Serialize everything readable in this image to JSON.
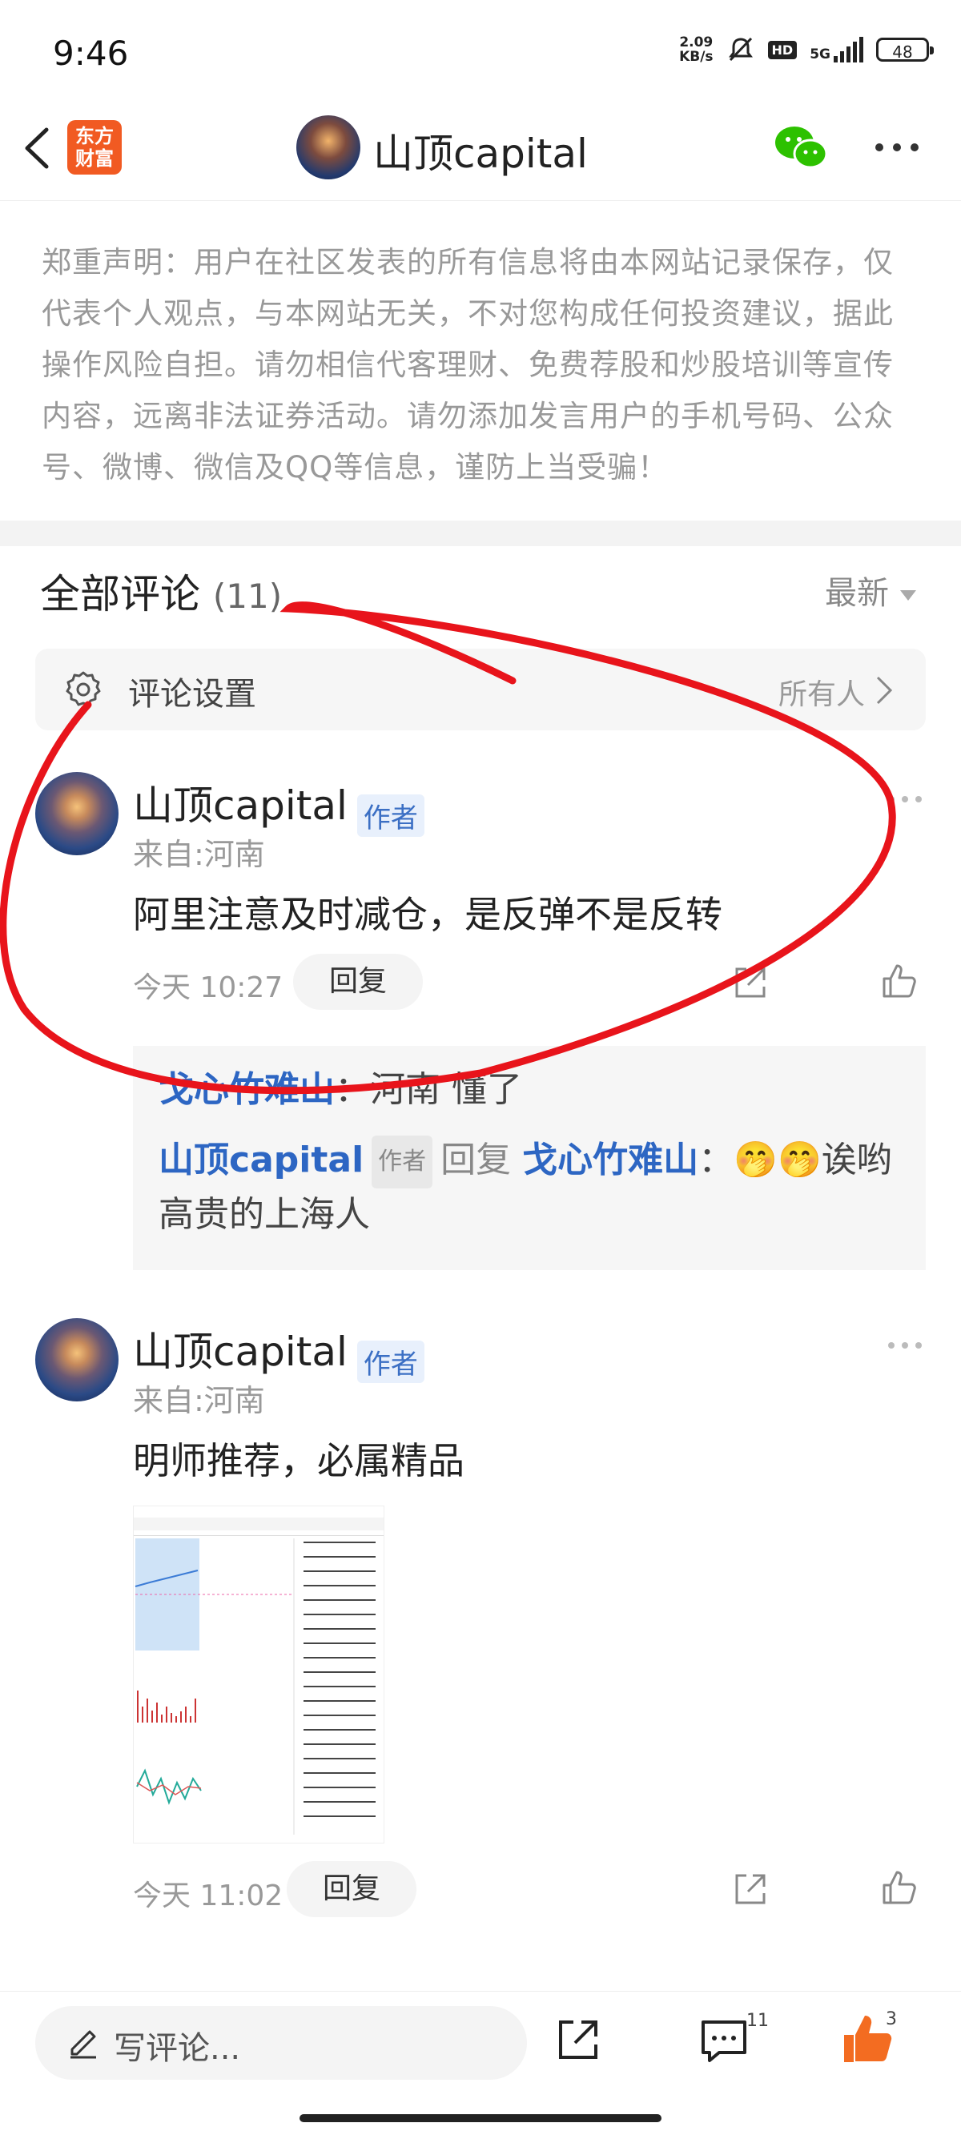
{
  "status": {
    "time": "9:46",
    "net_speed_value": "2.09",
    "net_speed_unit": "KB/s",
    "hd": "HD",
    "network": "5G",
    "battery": "48"
  },
  "nav": {
    "logo_line1": "东方",
    "logo_line2": "财富",
    "title": "山顶capital"
  },
  "disclaimer": "郑重声明：用户在社区发表的所有信息将由本网站记录保存，仅代表个人观点，与本网站无关，不对您构成任何投资建议，据此操作风险自担。请勿相信代客理财、免费荐股和炒股培训等宣传内容，远离非法证券活动。请勿添加发言用户的手机号码、公众号、微博、微信及QQ等信息，谨防上当受骗！",
  "comments_header": {
    "title": "全部评论",
    "count": "(11)",
    "sort": "最新"
  },
  "settings": {
    "label": "评论设置",
    "value": "所有人"
  },
  "comments": [
    {
      "name": "山顶capital",
      "badge": "作者",
      "location": "来自:河南",
      "text": "阿里注意及时减仓，是反弹不是反转",
      "time": "今天 10:27",
      "reply": "回复",
      "replies": [
        {
          "user": "戈心竹难山",
          "sep": "：",
          "text": "河南 懂了"
        },
        {
          "user": "山顶capital",
          "badge": "作者",
          "verb": "回复",
          "target": "戈心竹难山",
          "sep": "：",
          "emoji": "🤭🤭",
          "text": "诶哟高贵的上海人"
        }
      ]
    },
    {
      "name": "山顶capital",
      "badge": "作者",
      "location": "来自:河南",
      "text": "明师推荐，必属精品",
      "time": "今天 11:02",
      "reply": "回复"
    }
  ],
  "bottom": {
    "input_placeholder": "写评论...",
    "comment_count": "11",
    "like_count": "3"
  },
  "colors": {
    "accent_blue": "#2d66c3",
    "brand_orange": "#f15a22",
    "like_orange": "#f36c21",
    "annotation_red": "#e8141b"
  },
  "icons": [
    "back-arrow-icon",
    "wechat-icon",
    "more-icon",
    "gear-icon",
    "chevron-right-icon",
    "share-icon",
    "like-icon",
    "pen-icon",
    "comment-icon"
  ]
}
